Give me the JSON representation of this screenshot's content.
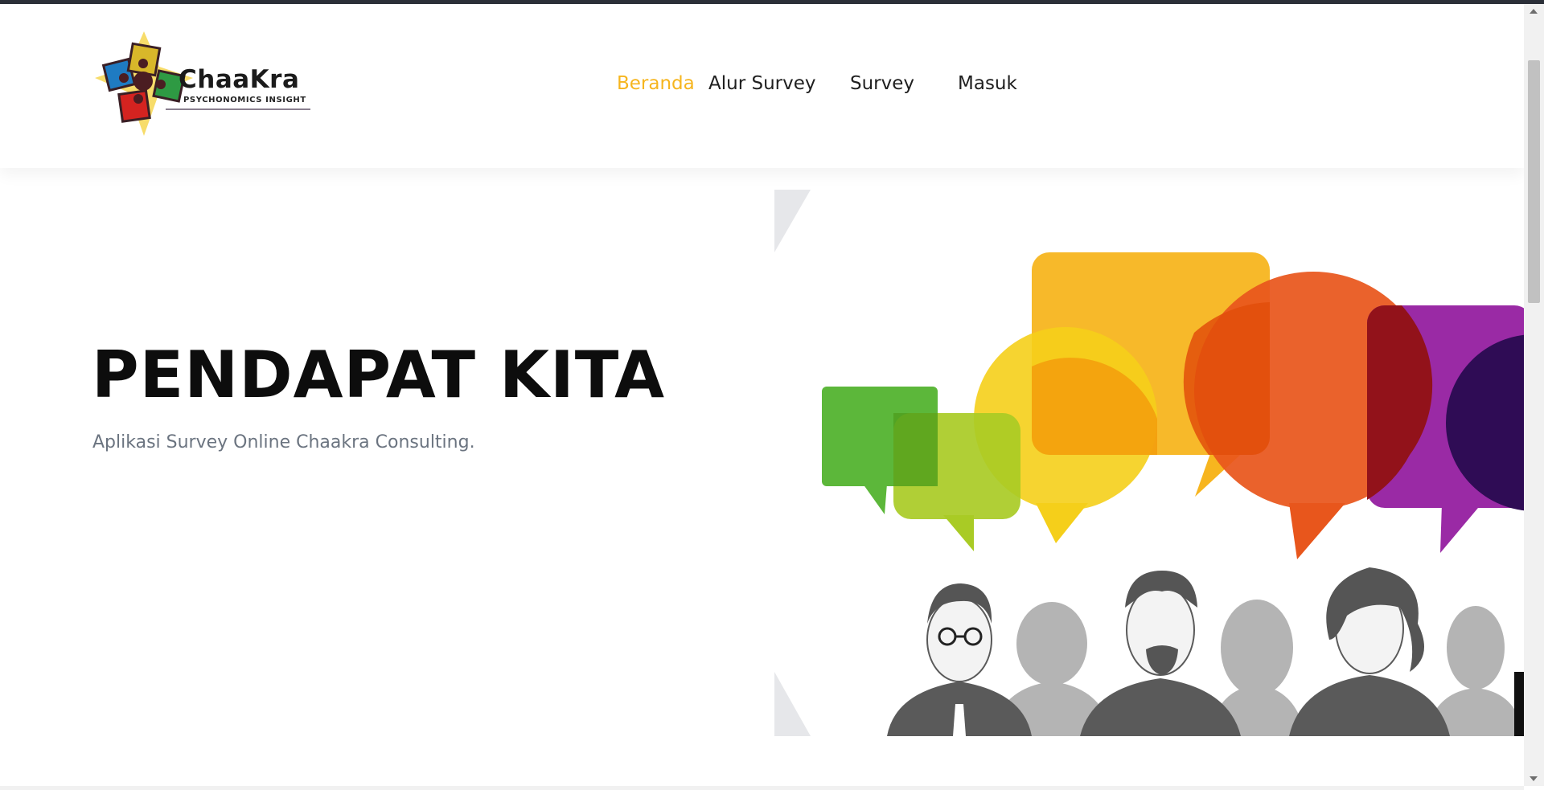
{
  "brand": {
    "name": "ChaaKra",
    "tagline": "PSYCHONOMICS INSIGHT"
  },
  "nav": {
    "items": [
      {
        "label": "Beranda",
        "active": true
      },
      {
        "label": "Alur Survey",
        "active": false
      },
      {
        "label": "Survey",
        "active": false
      },
      {
        "label": "Masuk",
        "active": false
      }
    ]
  },
  "hero": {
    "title": "PENDAPAT KITA",
    "subtitle": "Aplikasi Survey Online Chaakra Consulting."
  },
  "colors": {
    "accent": "#f6b51e",
    "text": "#1f1f1f",
    "subtitle": "#6b7480"
  }
}
